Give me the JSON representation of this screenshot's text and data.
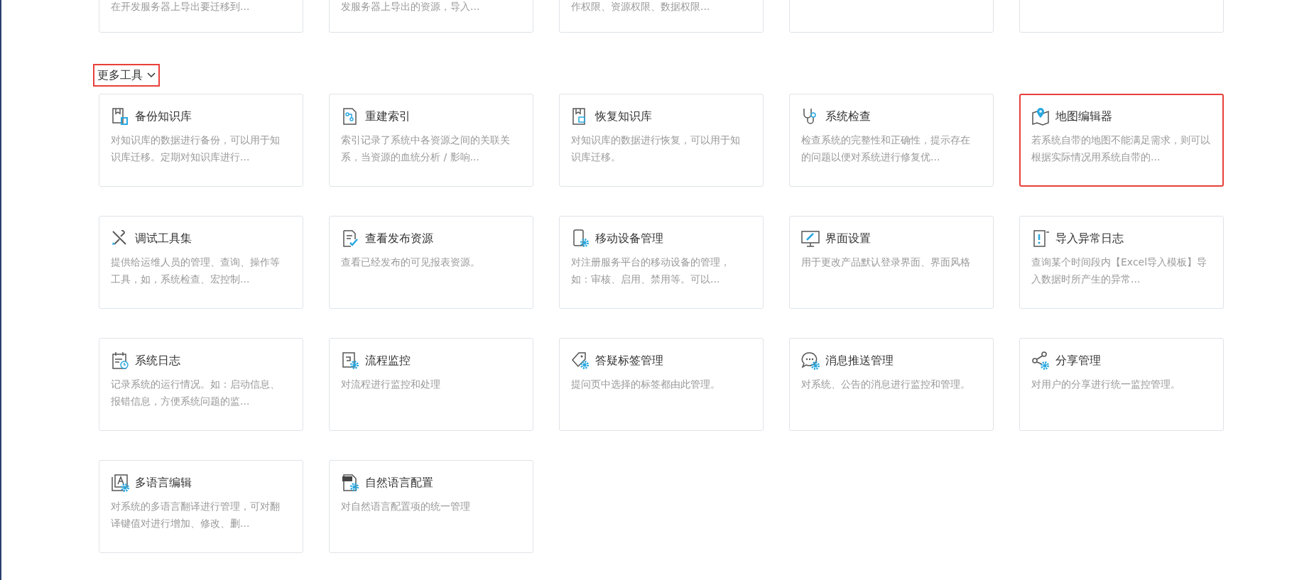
{
  "top_cards": [
    {
      "kind": "text",
      "description": "在开发服务器上导出要迁移到..."
    },
    {
      "kind": "text",
      "description": "发服务器上导出的资源，导入..."
    },
    {
      "kind": "text",
      "description": "作权限、资源权限、数据权限..."
    },
    {
      "kind": "blank"
    },
    {
      "kind": "blank"
    }
  ],
  "section": {
    "title": "更多工具",
    "expanded": true,
    "highlighted": true
  },
  "tools": [
    {
      "title": "备份知识库",
      "description": "对知识库的数据进行备份，可以用于知识库迁移。定期对知识库进行...",
      "highlighted": false
    },
    {
      "title": "重建索引",
      "description": "索引记录了系统中各资源之间的关联关系，当资源的血统分析 / 影响...",
      "highlighted": false
    },
    {
      "title": "恢复知识库",
      "description": "对知识库的数据进行恢复，可以用于知识库迁移。",
      "highlighted": false
    },
    {
      "title": "系统检查",
      "description": "检查系统的完整性和正确性，提示存在的问题以便对系统进行修复优...",
      "highlighted": false
    },
    {
      "title": "地图编辑器",
      "description": "若系统自带的地图不能满足需求，则可以根据实际情况用系统自带的...",
      "highlighted": true
    },
    {
      "title": "调试工具集",
      "description": "提供给运维人员的管理、查询、操作等工具，如，系统检查、宏控制...",
      "highlighted": false
    },
    {
      "title": "查看发布资源",
      "description": "查看已经发布的可见报表资源。",
      "highlighted": false
    },
    {
      "title": "移动设备管理",
      "description": "对注册服务平台的移动设备的管理，如：审核、启用、禁用等。可以...",
      "highlighted": false
    },
    {
      "title": "界面设置",
      "description": "用于更改产品默认登录界面、界面风格",
      "highlighted": false
    },
    {
      "title": "导入异常日志",
      "description": "查询某个时间段内【Excel导入模板】导入数据时所产生的异常...",
      "highlighted": false
    },
    {
      "title": "系统日志",
      "description": "记录系统的运行情况。如：启动信息、报错信息，方便系统问题的监...",
      "highlighted": false
    },
    {
      "title": "流程监控",
      "description": "对流程进行监控和处理",
      "highlighted": false
    },
    {
      "title": "答疑标签管理",
      "description": "提问页中选择的标签都由此管理。",
      "highlighted": false
    },
    {
      "title": "消息推送管理",
      "description": "对系统、公告的消息进行监控和管理。",
      "highlighted": false
    },
    {
      "title": "分享管理",
      "description": "对用户的分享进行统一监控管理。",
      "highlighted": false
    },
    {
      "title": "多语言编辑",
      "description": "对系统的多语言翻译进行管理，可对翻译键值对进行增加、修改、删...",
      "highlighted": false
    },
    {
      "title": "自然语言配置",
      "description": "对自然语言配置项的统一管理",
      "highlighted": false
    }
  ]
}
